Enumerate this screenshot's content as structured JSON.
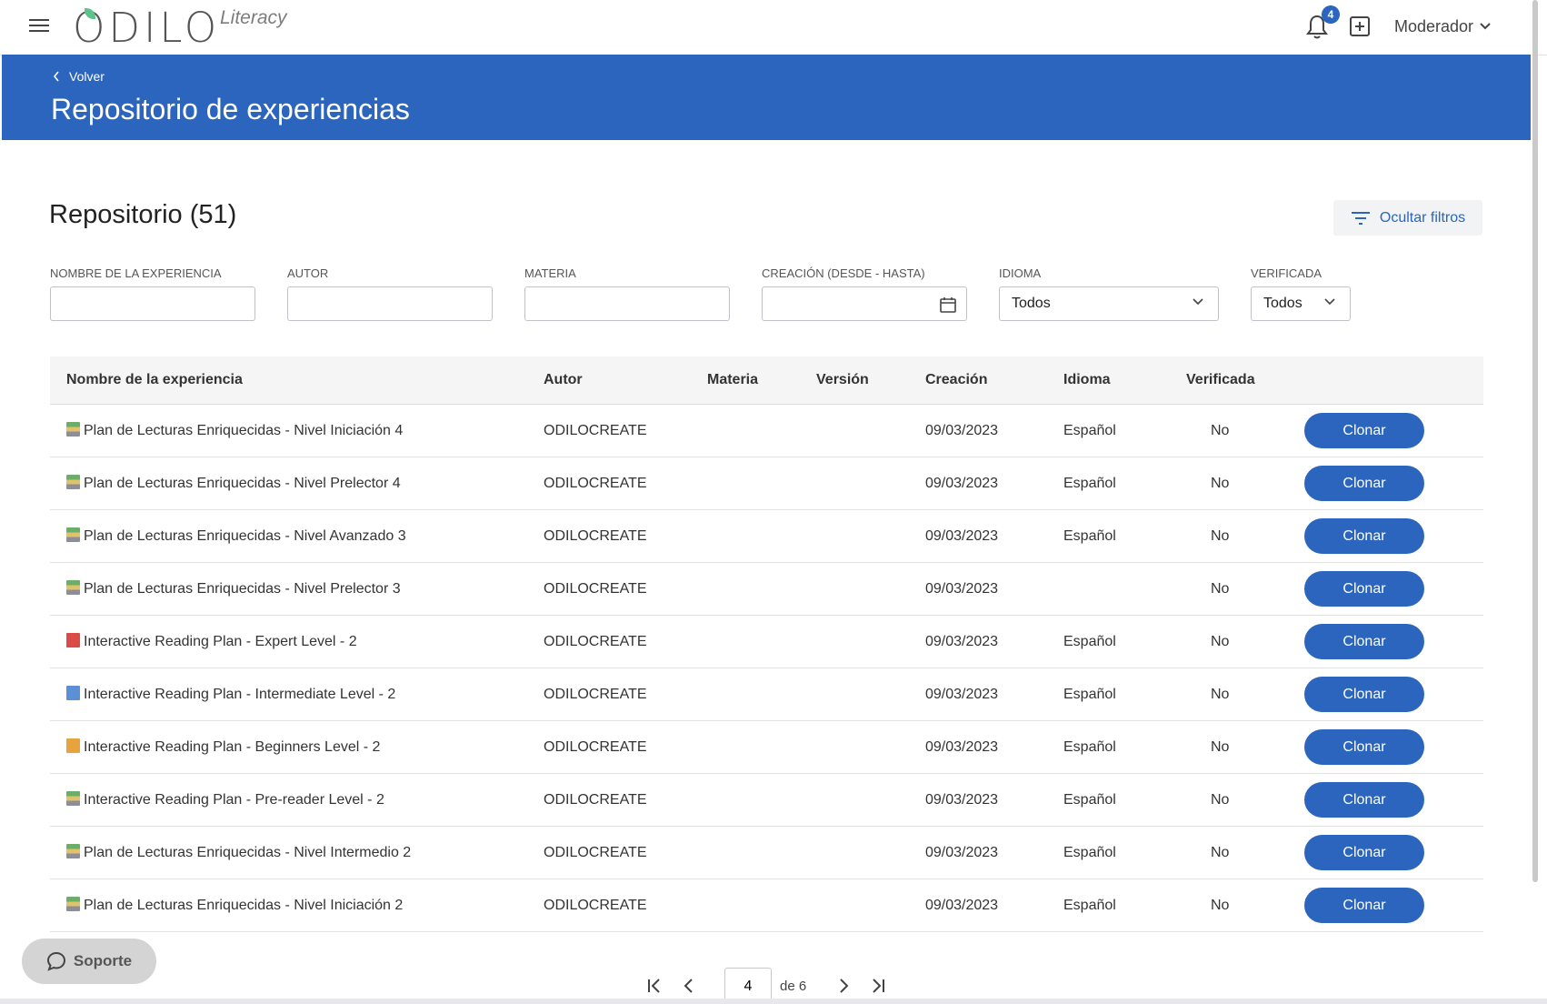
{
  "app": {
    "logo_text": "ODILO",
    "logo_sub": "Literacy",
    "notifications_count": "4",
    "user_label": "Moderador"
  },
  "hero": {
    "back_label": "Volver",
    "title": "Repositorio de experiencias"
  },
  "repo": {
    "title": "Repositorio (51)",
    "filters_toggle": "Ocultar filtros"
  },
  "filters": {
    "name_label": "NOMBRE DE LA EXPERIENCIA",
    "author_label": "AUTOR",
    "subject_label": "MATERIA",
    "created_label": "CREACIÓN (DESDE - HASTA)",
    "language_label": "IDIOMA",
    "language_value": "Todos",
    "verified_label": "VERIFICADA",
    "verified_value": "Todos"
  },
  "table": {
    "headers": [
      "Nombre de la experiencia",
      "Autor",
      "Materia",
      "Versión",
      "Creación",
      "Idioma",
      "Verificada"
    ],
    "action_label": "Clonar",
    "rows": [
      {
        "icon": "stacked-books-icon",
        "name": "Plan de Lecturas Enriquecidas - Nivel Iniciación 4",
        "author": "ODILOCREATE",
        "subject": "",
        "version": "",
        "created": "09/03/2023",
        "language": "Español",
        "verified": "No"
      },
      {
        "icon": "stacked-books-icon",
        "name": "Plan de Lecturas Enriquecidas - Nivel Prelector 4",
        "author": "ODILOCREATE",
        "subject": "",
        "version": "",
        "created": "09/03/2023",
        "language": "Español",
        "verified": "No"
      },
      {
        "icon": "stacked-books-icon",
        "name": "Plan de Lecturas Enriquecidas - Nivel Avanzado 3",
        "author": "ODILOCREATE",
        "subject": "",
        "version": "",
        "created": "09/03/2023",
        "language": "Español",
        "verified": "No"
      },
      {
        "icon": "stacked-books-icon",
        "name": "Plan de Lecturas Enriquecidas - Nivel Prelector 3",
        "author": "ODILOCREATE",
        "subject": "",
        "version": "",
        "created": "09/03/2023",
        "language": "",
        "verified": "No"
      },
      {
        "icon": "red-book-icon",
        "name": "Interactive Reading Plan - Expert Level - 2",
        "author": "ODILOCREATE",
        "subject": "",
        "version": "",
        "created": "09/03/2023",
        "language": "Español",
        "verified": "No"
      },
      {
        "icon": "blue-book-icon",
        "name": "Interactive Reading Plan - Intermediate Level - 2",
        "author": "ODILOCREATE",
        "subject": "",
        "version": "",
        "created": "09/03/2023",
        "language": "Español",
        "verified": "No"
      },
      {
        "icon": "orange-book-icon",
        "name": "Interactive Reading Plan - Beginners Level - 2",
        "author": "ODILOCREATE",
        "subject": "",
        "version": "",
        "created": "09/03/2023",
        "language": "Español",
        "verified": "No"
      },
      {
        "icon": "stacked-books-icon",
        "name": "Interactive Reading Plan - Pre-reader Level - 2",
        "author": "ODILOCREATE",
        "subject": "",
        "version": "",
        "created": "09/03/2023",
        "language": "Español",
        "verified": "No"
      },
      {
        "icon": "stacked-books-icon",
        "name": "Plan de Lecturas Enriquecidas - Nivel Intermedio 2",
        "author": "ODILOCREATE",
        "subject": "",
        "version": "",
        "created": "09/03/2023",
        "language": "Español",
        "verified": "No"
      },
      {
        "icon": "stacked-books-icon",
        "name": "Plan de Lecturas Enriquecidas - Nivel Iniciación 2",
        "author": "ODILOCREATE",
        "subject": "",
        "version": "",
        "created": "09/03/2023",
        "language": "Español",
        "verified": "No"
      }
    ]
  },
  "support": {
    "label": "Soporte"
  },
  "pagination": {
    "current_page": "4",
    "of_label": "de 6"
  },
  "colors": {
    "primary": "#2b65bd",
    "header_bg": "#f5f5f5",
    "support_bg": "#d4d4d4",
    "book_red": "#d94a48",
    "book_blue": "#5b8fd6",
    "book_orange": "#e8a43c",
    "book_stack": "#6cae68"
  }
}
